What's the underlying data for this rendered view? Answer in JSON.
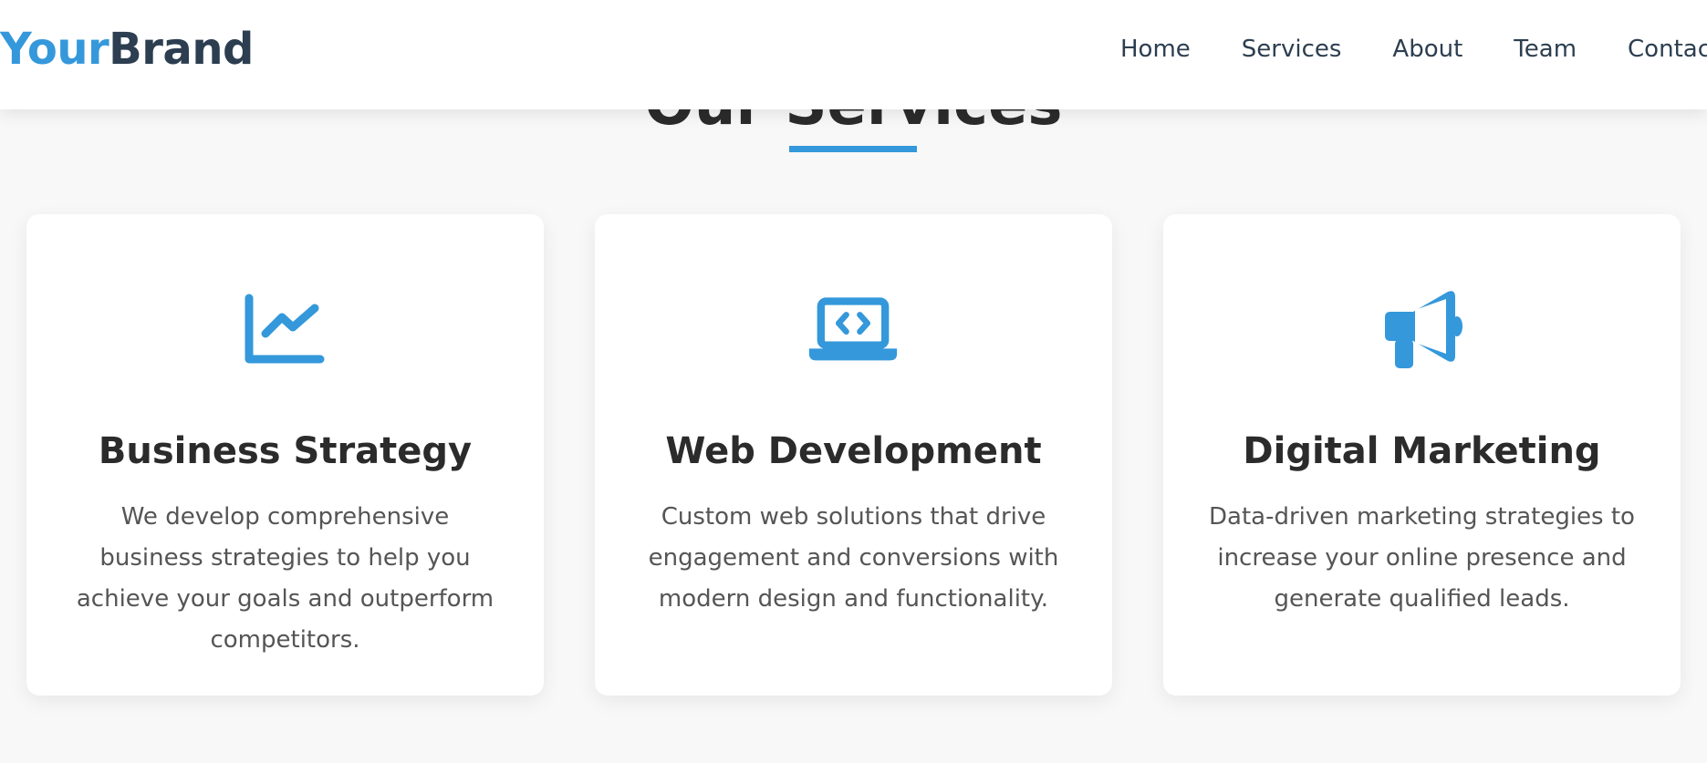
{
  "header": {
    "brand_part1": "Your",
    "brand_part2": "Brand",
    "nav": [
      "Home",
      "Services",
      "About",
      "Team",
      "Contact"
    ]
  },
  "section": {
    "title": "Our Services"
  },
  "cards": [
    {
      "icon": "chart-line-icon",
      "title": "Business Strategy",
      "description": "We develop comprehensive business strategies to help you achieve your goals and outperform competitors."
    },
    {
      "icon": "laptop-code-icon",
      "title": "Web Development",
      "description": "Custom web solutions that drive engagement and conversions with modern design and functionality."
    },
    {
      "icon": "megaphone-icon",
      "title": "Digital Marketing",
      "description": "Data-driven marketing strategies to increase your online presence and generate qualified leads."
    }
  ],
  "colors": {
    "accent": "#3498db",
    "brand_dark": "#2c3e50",
    "heading": "#2b2b2b",
    "body_text": "#555555",
    "background": "#f8f8f8"
  }
}
